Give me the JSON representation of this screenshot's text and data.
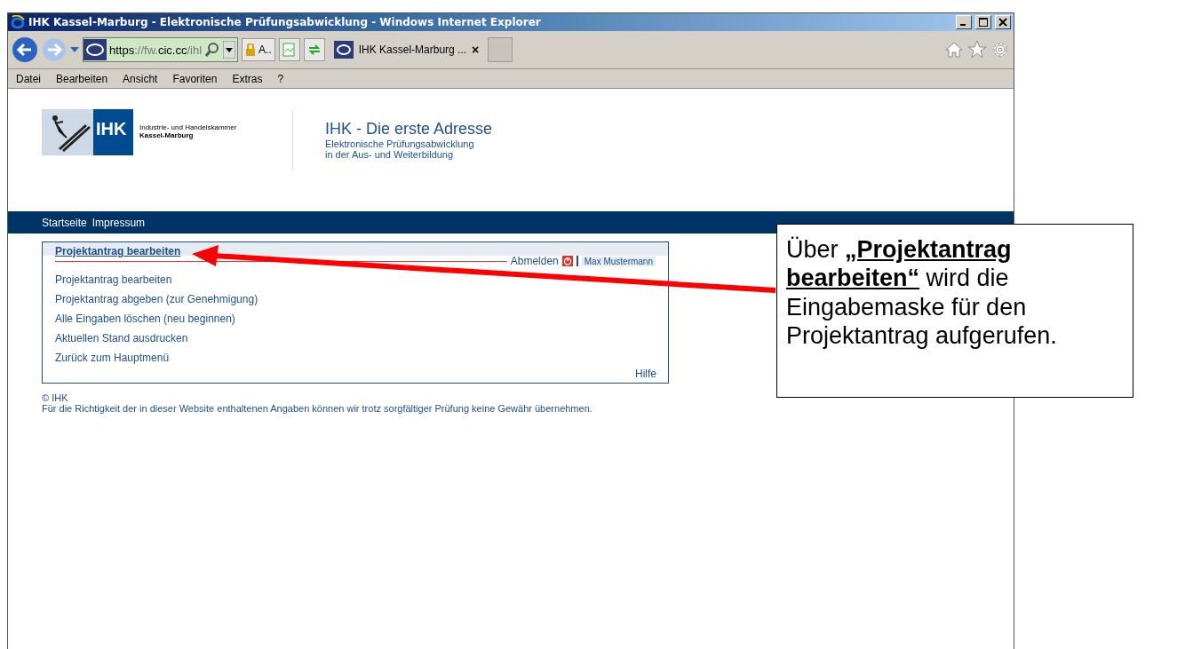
{
  "window": {
    "title": "IHK Kassel-Marburg - Elektronische Prüfungsabwicklung - Windows Internet Explorer"
  },
  "address_bar": {
    "url_prefix": "https",
    "url_rest": "://fw.",
    "url_host": "cic.cc",
    "url_tail": "/ihl",
    "security": "A.."
  },
  "tab": {
    "label": "IHK Kassel-Marburg ...",
    "close": "×"
  },
  "menu": [
    "Datei",
    "Bearbeiten",
    "Ansicht",
    "Favoriten",
    "Extras",
    "?"
  ],
  "header": {
    "logo_text": "IHK",
    "org_line1": "Industrie- und Handelskammer",
    "org_line2": "Kassel-Marburg",
    "title": "IHK - Die erste Adresse",
    "subtitle_1": "Elektronische Prüfungsabwicklung",
    "subtitle_2": "in der Aus- und Weiterbildung"
  },
  "nav": [
    "Startseite",
    "Impressum"
  ],
  "panel": {
    "title": "Projektantrag bearbeiten",
    "logout": "Abmelden",
    "user": "Max Mustermann",
    "links": [
      "Projektantrag bearbeiten",
      "Projektantrag abgeben (zur Genehmigung)",
      "Alle Eingaben löschen (neu beginnen)",
      "Aktuellen Stand ausdrucken",
      "Zurück zum Hauptmenü"
    ],
    "help": "Hilfe"
  },
  "footer": {
    "copyright": "© IHK",
    "disclaimer": "Für die Richtigkeit der in dieser Website enthaltenen Angaben können wir trotz sorgfältiger Prüfung keine Gewähr übernehmen."
  },
  "callout": {
    "text": "Über **„Projektantrag bearbeiten“** wird die Eingabemaske für den Projektantrag aufgerufen."
  }
}
